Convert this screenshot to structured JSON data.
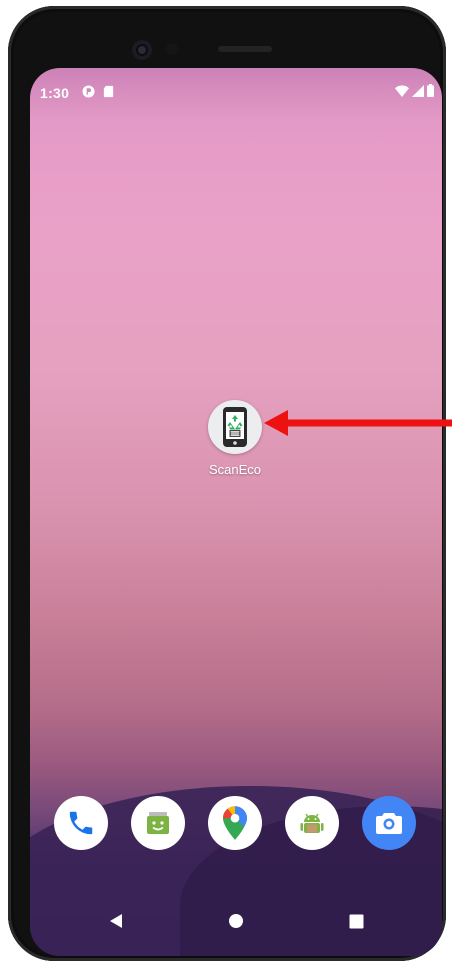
{
  "status_bar": {
    "time": "1:30",
    "left_icons": [
      "app-notification-icon",
      "sd-card-icon"
    ],
    "right_icons": [
      "wifi-icon",
      "cell-signal-icon",
      "battery-icon"
    ]
  },
  "home": {
    "app": {
      "label": "ScanEco",
      "icon": "recycle-phone-icon"
    }
  },
  "dock": {
    "apps": [
      "phone-icon",
      "messages-icon",
      "maps-icon",
      "android-icon",
      "camera-icon"
    ]
  },
  "nav": {
    "buttons": [
      "back-icon",
      "home-icon",
      "recents-icon"
    ]
  },
  "annotation": {
    "arrow_color": "#ee1111"
  }
}
